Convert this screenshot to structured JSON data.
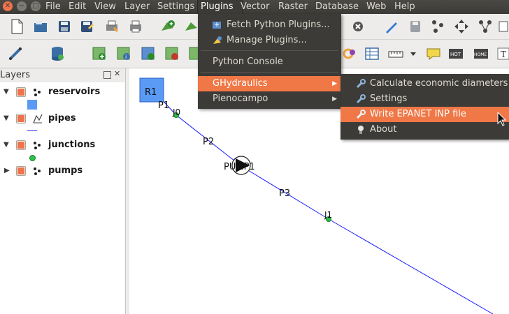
{
  "window_buttons": [
    "close",
    "minimize",
    "maximize"
  ],
  "menu": {
    "items": [
      {
        "label": "File"
      },
      {
        "label": "Edit"
      },
      {
        "label": "View"
      },
      {
        "label": "Layer"
      },
      {
        "label": "Settings"
      },
      {
        "label": "Plugins"
      },
      {
        "label": "Vector"
      },
      {
        "label": "Raster"
      },
      {
        "label": "Database"
      },
      {
        "label": "Web"
      },
      {
        "label": "Help"
      }
    ],
    "active": "Plugins"
  },
  "plugins_menu": {
    "items": [
      {
        "label": "Fetch Python Plugins...",
        "icon": "plugin-fetch-icon"
      },
      {
        "label": "Manage Plugins...",
        "icon": "plugin-manage-icon"
      },
      {
        "label": "Python Console"
      },
      {
        "label": "GHydraulics",
        "has_submenu": true,
        "highlighted": true
      },
      {
        "label": "Pienocampo",
        "has_submenu": true
      }
    ]
  },
  "ghydraulics_submenu": {
    "items": [
      {
        "label": "Calculate economic diameters",
        "icon": "wrench-icon"
      },
      {
        "label": "Settings",
        "icon": "wrench-icon"
      },
      {
        "label": "Write EPANET INP file",
        "icon": "wrench-icon",
        "highlighted": true
      },
      {
        "label": "About",
        "icon": "lightbulb-icon"
      }
    ]
  },
  "layers_panel": {
    "title": "Layers",
    "layers": [
      {
        "name": "reservoirs",
        "expanded": true,
        "checked": true,
        "legend": "blue-square"
      },
      {
        "name": "pipes",
        "expanded": true,
        "checked": true,
        "legend": "blue-line"
      },
      {
        "name": "junctions",
        "expanded": true,
        "checked": true,
        "legend": "green-dot"
      },
      {
        "name": "pumps",
        "expanded": false,
        "checked": true,
        "legend": null
      }
    ]
  },
  "map": {
    "labels": {
      "reservoir": "R1",
      "junction0": "J0",
      "junction1": "J1",
      "pipe1": "P1",
      "pipe2": "P2",
      "pipe3": "P3",
      "pump": "PUMP1"
    },
    "colors": {
      "pipe": "#1f1fff",
      "reservoir_fill": "#5a9af5",
      "junction": "#2cc24a",
      "highlight": "#f07746"
    }
  }
}
